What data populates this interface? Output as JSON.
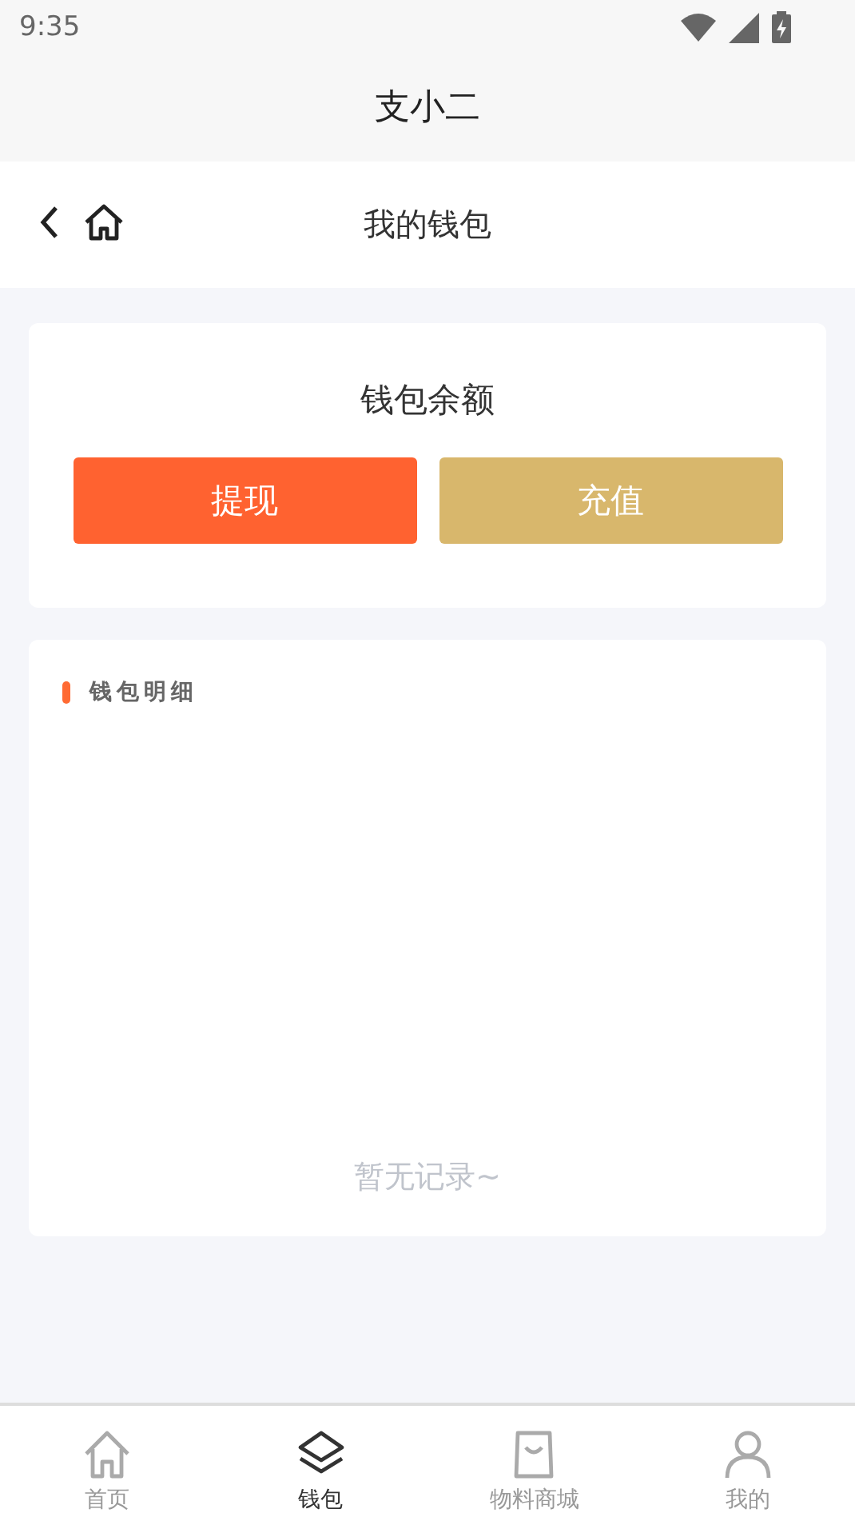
{
  "status_bar": {
    "time": "9:35"
  },
  "app_title": "支小二",
  "nav_bar": {
    "title": "我的钱包"
  },
  "balance_card": {
    "title": "钱包余额",
    "buttons": [
      {
        "label": "提现",
        "kind": "withdraw"
      },
      {
        "label": "充值",
        "kind": "recharge"
      }
    ]
  },
  "details_card": {
    "title": "钱包明细",
    "empty_text": "暂无记录~"
  },
  "tab_bar": [
    {
      "label": "首页",
      "kind": "home",
      "selected": false
    },
    {
      "label": "钱包",
      "kind": "layers",
      "selected": true
    },
    {
      "label": "物料商城",
      "kind": "bag",
      "selected": false
    },
    {
      "label": "我的",
      "kind": "user",
      "selected": false
    }
  ]
}
